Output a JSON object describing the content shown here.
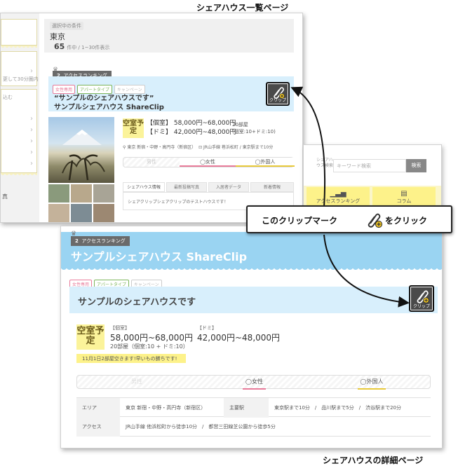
{
  "captions": {
    "list_page": "シェアハウス一覧ページ",
    "detail_page": "シェアハウスの詳細ページ"
  },
  "list_page": {
    "sidebar": {
      "text_1": "更して30分圏内",
      "text_2": "込む",
      "text_3": "真"
    },
    "condition": {
      "label": "選択中の条件",
      "city": "東京",
      "count": "65",
      "count_suffix": "件中 / 1~30件表示"
    },
    "ranking": {
      "number": "2",
      "label": "アクセスランキング"
    },
    "tags": [
      "女性専用",
      "アパートタイプ",
      "キャンペーン"
    ],
    "title_line1": "“サンプルのシェアハウスです”",
    "title_line2": "サンプルシェアハウス ShareClip",
    "clip_label": "クリップ",
    "vacancy": "空室予定",
    "price_private": "【個室】 58,000円~68,000円",
    "price_dorm": "【ドミ】 42,000円~48,000円",
    "rooms": "20部屋",
    "rooms_detail": "(個室:10+ドミ:10)",
    "location": "東京 新宿・中野・高円寺（新宿区）",
    "station": "JR山手線 巷浜松町 / 東京駅まで10分",
    "gender": {
      "male": "男性",
      "female": "◯女性",
      "foreign": "◯外国人"
    },
    "tabs": [
      "シェアハウス情報",
      "最新投稿写真",
      "入居者データ",
      "新着情報"
    ],
    "tab_body": "シェアクリップシェアクリップのテストハウスです！"
  },
  "middle_page": {
    "search_label": "シェアハウス検索",
    "search_placeholder": "キーワード検索",
    "search_button": "検索",
    "menu_1": "アクセスランキング",
    "menu_2": "コラム"
  },
  "detail_page": {
    "ranking": {
      "number": "2",
      "label": "アクセスランキング"
    },
    "title": "サンプルシェアハウス ShareClip",
    "tags": [
      "女性専用",
      "アパートタイプ",
      "キャンペーン"
    ],
    "subtitle": "サンプルのシェアハウスです",
    "clip_label": "クリップ",
    "vacancy": "空室予定",
    "private_label": "【個室】",
    "private_price": "58,000円~68,000円",
    "dorm_label": "【ドミ】",
    "dorm_price": "42,000円~48,000円",
    "rooms": "20部屋（個室:10 + ドミ:10）",
    "notice": "11月1日2部屋空きます!早いもの勝ちです!",
    "gender": {
      "male": "男性",
      "female": "◯女性",
      "foreign": "◯外国人"
    },
    "table": {
      "area_label": "エリア",
      "area_value": "東京 新宿・中野・高円寺（新宿区）",
      "station_label": "主要駅",
      "station_value": "東京駅まで10分　/　品川駅まで5分　/　渋谷駅まで20分",
      "access_label": "アクセス",
      "access_value": "JR山手線 他浜松町から徒歩10分　/　都営三田線芝公園から徒歩5分"
    }
  },
  "callout": {
    "text_before": "このクリップマーク",
    "text_after": "をクリック"
  },
  "colors": {
    "header_blue": "#9ad4f2",
    "light_blue": "#d8effc",
    "vacancy_yellow": "#fbf39a",
    "female_pink": "#e87b9a",
    "foreign_yellow": "#e8c93a"
  }
}
